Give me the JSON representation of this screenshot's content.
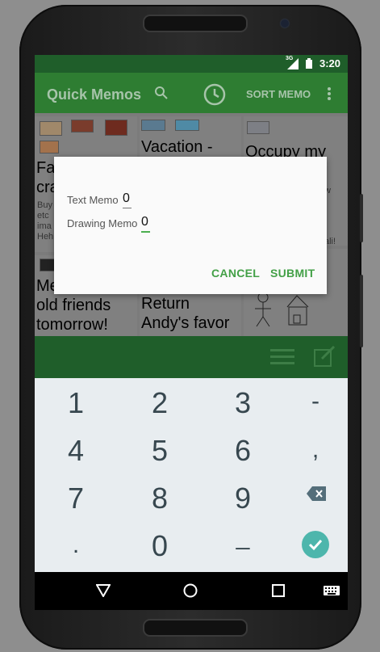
{
  "status_bar": {
    "network": "3G",
    "time": "3:20"
  },
  "app_bar": {
    "title": "Quick Memos",
    "sort_label": "SORT MEMO",
    "icons": [
      "search-icon",
      "history-icon",
      "more-vert-icon"
    ]
  },
  "memos": [
    {
      "title": "Fa",
      "title_line2": "cra",
      "snippet": [
        "Buy",
        "etc",
        "ima",
        "Heh"
      ]
    },
    {
      "title": "Vacation -"
    },
    {
      "title": "Occupy my",
      "title_line2": "",
      "snippet_right": "w",
      "tag": "ali!"
    },
    {
      "title": "Meeting my",
      "title_line2": "old friends",
      "title_line3": "tomorrow!"
    },
    {
      "title": "Return",
      "title_line2": "Andy's favor"
    }
  ],
  "bottom_bar": {
    "icons": [
      "list-icon",
      "edit-icon"
    ]
  },
  "dialog": {
    "text_memo_label": "Text Memo",
    "text_memo_value": "0",
    "drawing_memo_label": "Drawing Memo",
    "drawing_memo_value": "0",
    "cancel_label": "CANCEL",
    "submit_label": "SUBMIT"
  },
  "keypad": {
    "keys": [
      "1",
      "2",
      "3",
      "-",
      "4",
      "5",
      "6",
      ",",
      "7",
      "8",
      "9",
      ".",
      "0",
      "_"
    ],
    "icons": [
      "backspace-icon",
      "done-icon"
    ]
  },
  "nav_bar": {
    "icons": [
      "back-icon",
      "home-icon",
      "recents-icon",
      "keyboard-icon"
    ]
  },
  "colors": {
    "primary": "#2e7d32",
    "primary_dark": "#1f5e2a",
    "accent": "#43a047",
    "keypad_done": "#4db6ac"
  }
}
